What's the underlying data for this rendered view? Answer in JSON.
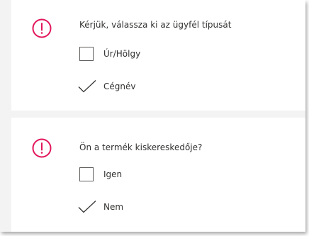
{
  "questions": [
    {
      "text": "Kérjük, válassza ki az ügyfél típusát",
      "options": [
        {
          "label": "Úr/Hölgy",
          "checked": false
        },
        {
          "label": "Cégnév",
          "checked": true
        }
      ]
    },
    {
      "text": "Ön a termék kiskereskedője?",
      "options": [
        {
          "label": "Igen",
          "checked": false
        },
        {
          "label": "Nem",
          "checked": true
        }
      ]
    }
  ],
  "colors": {
    "alert": "#e3165b",
    "text": "#323130",
    "separator": "#f3f3f3"
  },
  "icons": {
    "alert": "exclamation-circle-icon",
    "checked": "checkmark-icon",
    "unchecked": "empty-checkbox"
  }
}
